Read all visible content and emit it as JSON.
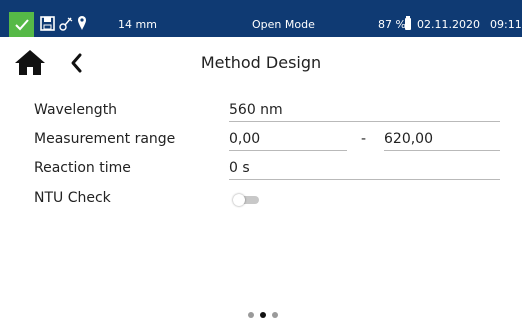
{
  "status_bar": {
    "background": "#0f3a73",
    "check_color": "#56b947",
    "icons": [
      "check-icon",
      "save-icon",
      "probe-icon",
      "location-pin-icon"
    ],
    "path_length": "14 mm",
    "mode": "Open Mode",
    "battery_percent": "87 %",
    "date": "02.11.2020",
    "time": "09:11"
  },
  "header": {
    "home_icon": "home-icon",
    "back_icon": "chevron-left-icon",
    "title": "Method Design"
  },
  "form": {
    "wavelength": {
      "label": "Wavelength",
      "value": "560 nm"
    },
    "measurement_range": {
      "label": "Measurement range",
      "min": "0,00",
      "separator": "-",
      "max": "620,00"
    },
    "reaction_time": {
      "label": "Reaction time",
      "value": "0 s"
    },
    "ntu_check": {
      "label": "NTU Check",
      "enabled": false
    }
  },
  "pager": {
    "pages": 3,
    "active_index": 1
  }
}
